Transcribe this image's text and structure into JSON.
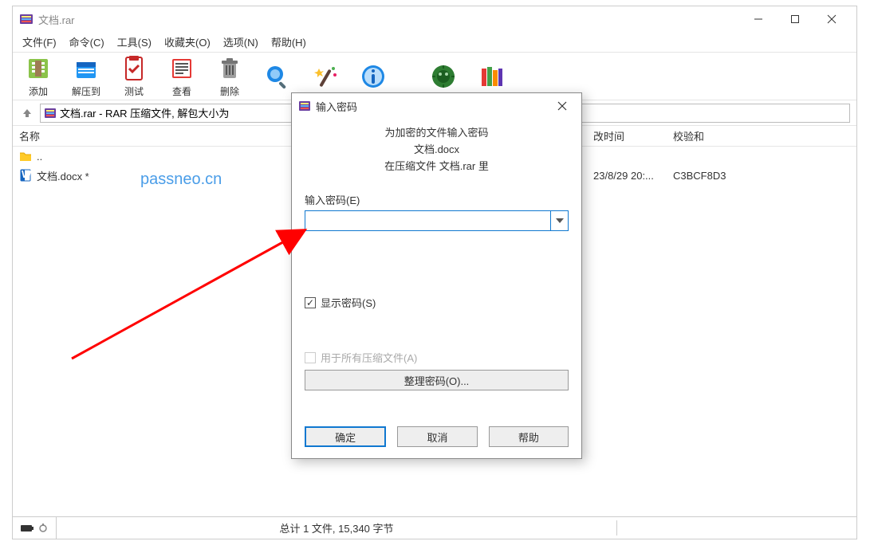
{
  "window": {
    "title": "文档.rar",
    "menus": [
      "文件(F)",
      "命令(C)",
      "工具(S)",
      "收藏夹(O)",
      "选项(N)",
      "帮助(H)"
    ],
    "toolbar": {
      "add": "添加",
      "extract": "解压到",
      "test": "测试",
      "view": "查看",
      "delete": "删除"
    },
    "address": "文档.rar - RAR 压缩文件, 解包大小为",
    "columns": {
      "name": "名称",
      "mtime": "改时间",
      "checksum": "校验和"
    },
    "rows": [
      {
        "name": "..",
        "mtime": "",
        "checksum": "",
        "icon": "folder"
      },
      {
        "name": "文档.docx *",
        "mtime": "23/8/29 20:...",
        "checksum": "C3BCF8D3",
        "icon": "docx"
      }
    ],
    "watermark": "passneo.cn",
    "status": "总计 1 文件, 15,340 字节"
  },
  "dialog": {
    "title": "输入密码",
    "msg1": "为加密的文件输入密码",
    "msg2": "文档.docx",
    "msg3": "在压缩文件 文档.rar 里",
    "input_label": "输入密码(E)",
    "show_pw": "显示密码(S)",
    "use_all": "用于所有压缩文件(A)",
    "organize": "整理密码(O)...",
    "ok": "确定",
    "cancel": "取消",
    "help": "帮助"
  }
}
